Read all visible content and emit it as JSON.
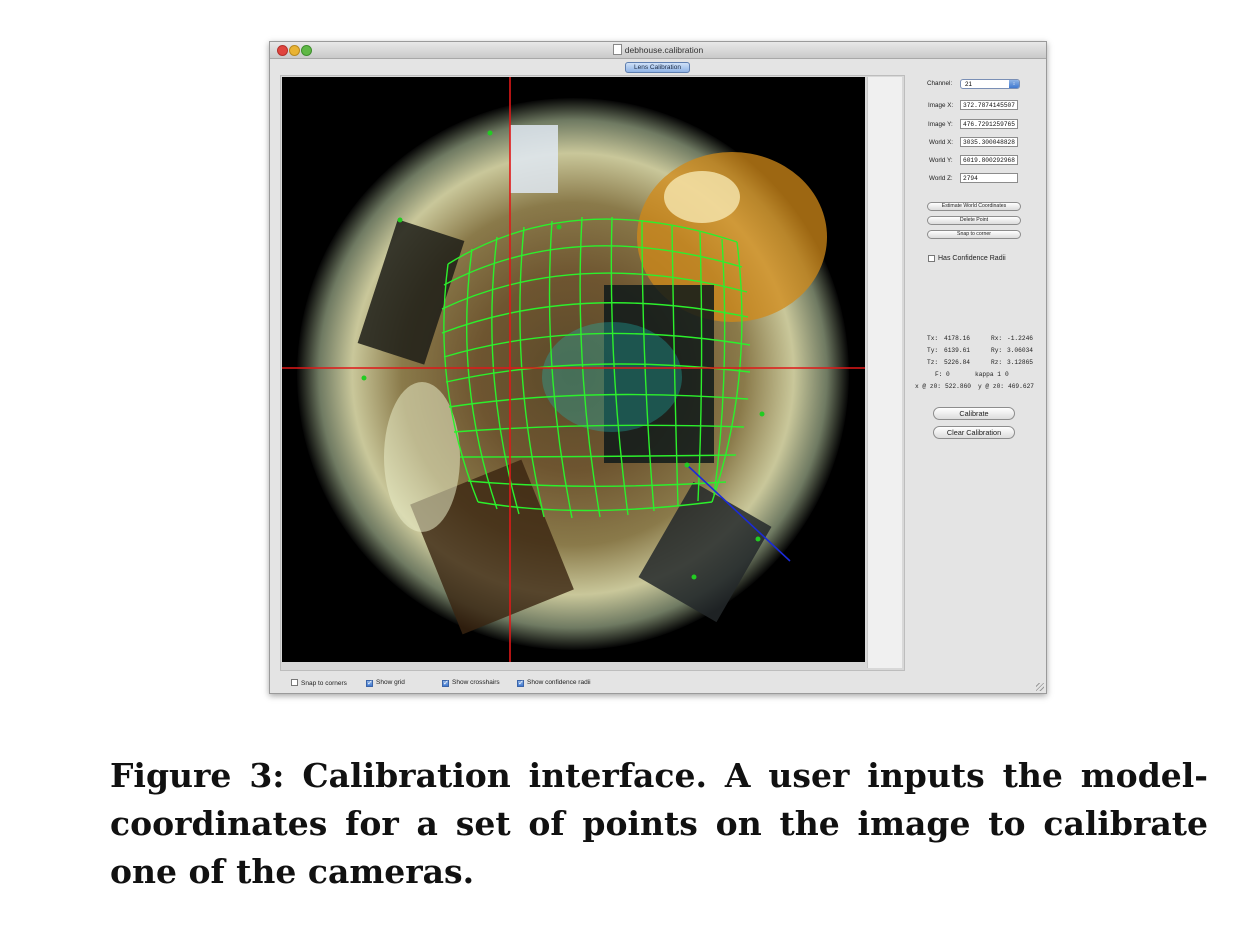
{
  "window": {
    "title": "debhouse.calibration",
    "tab_label": "Lens Calibration"
  },
  "sidebar": {
    "channel_label": "Channel:",
    "channel_value": "21",
    "image_x_label": "Image X:",
    "image_x_value": "372.7874145507",
    "image_y_label": "Image Y:",
    "image_y_value": "476.7291259765",
    "world_x_label": "World X:",
    "world_x_value": "3035.300048828",
    "world_y_label": "World Y:",
    "world_y_value": "6019.800292968",
    "world_z_label": "World Z:",
    "world_z_value": "2794",
    "estimate_button": "Estimate World Coordinates",
    "delete_button": "Delete Point",
    "snap_button": "Snap to corner",
    "confidence_label": "Has Confidence Radii",
    "confidence_checked": false
  },
  "calibration": {
    "tx_label": "Tx:",
    "tx_value": "4178.16",
    "ty_label": "Ty:",
    "ty_value": "6139.61",
    "tz_label": "Tz:",
    "tz_value": "5226.84",
    "rx_label": "Rx:",
    "rx_value": "-1.2246",
    "ry_label": "Ry:",
    "ry_value": "3.06034",
    "rz_label": "Rz:",
    "rz_value": "3.12865",
    "f_label": "F:",
    "f_value": "0",
    "kappa_label": "kappa 1",
    "kappa_value": "0",
    "xz0_label": "x @ z0:",
    "xz0_value": "522.860",
    "yz0_label": "y @ z0:",
    "yz0_value": "469.627",
    "calibrate_button": "Calibrate",
    "clear_button": "Clear Calibration"
  },
  "bottom_bar": {
    "snap_corners": "Snap to corners",
    "snap_corners_checked": false,
    "show_grid": "Show grid",
    "show_grid_checked": true,
    "show_crosshairs": "Show crosshairs",
    "show_crosshairs_checked": true,
    "show_confidence": "Show confidence radii",
    "show_confidence_checked": true
  },
  "colors": {
    "crosshair": "#e01818",
    "grid": "#2cf02c",
    "line": "#1a2bd8",
    "point": "#22cc22"
  },
  "caption": "Figure 3: Calibration interface. A user inputs the model-coordinates for a set of points on the image to calibrate one of the cameras."
}
